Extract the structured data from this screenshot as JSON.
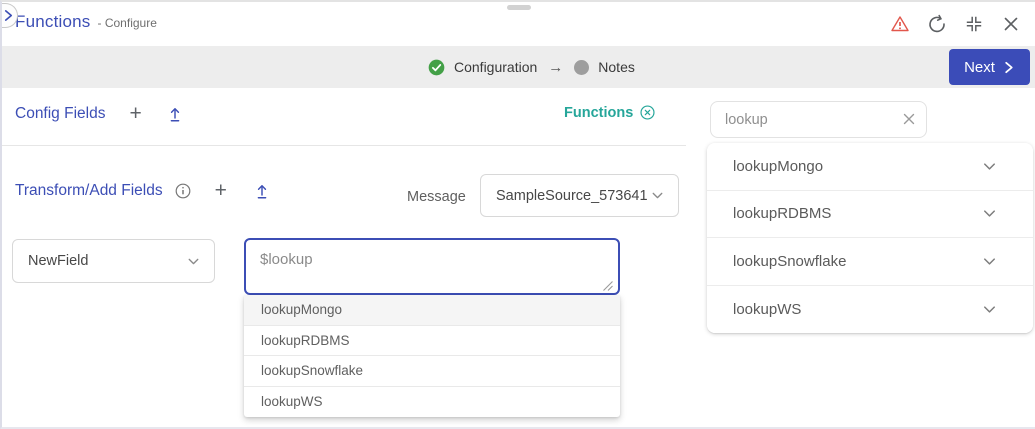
{
  "window": {
    "title": "Functions",
    "subtitle": "- Configure",
    "icons": {
      "collapse_tab": "chevron-right",
      "warning": "warning-triangle",
      "refresh": "refresh-arrow",
      "compress": "compress-corners",
      "close": "close-x"
    }
  },
  "stepper": {
    "step1": "Configuration",
    "arrow": "→",
    "step2": "Notes",
    "next_label": "Next"
  },
  "config_fields": {
    "title": "Config Fields"
  },
  "functions_chip": {
    "label": "Functions"
  },
  "transform": {
    "title": "Transform/Add Fields",
    "message_label": "Message",
    "message_value": "SampleSource_573641"
  },
  "field_row": {
    "field_name": "NewField",
    "expression": "$lookup"
  },
  "autocomplete": {
    "items": [
      "lookupMongo",
      "lookupRDBMS",
      "lookupSnowflake",
      "lookupWS"
    ]
  },
  "sidebar": {
    "search_value": "lookup",
    "functions": [
      "lookupMongo",
      "lookupRDBMS",
      "lookupSnowflake",
      "lookupWS"
    ]
  },
  "colors": {
    "indigo": "#3c4eb5",
    "button_indigo": "#3b4cb8",
    "teal": "#26a69a",
    "warning_red": "#e2574c",
    "success_green": "#43a047",
    "stepper_bg": "#ededed"
  }
}
